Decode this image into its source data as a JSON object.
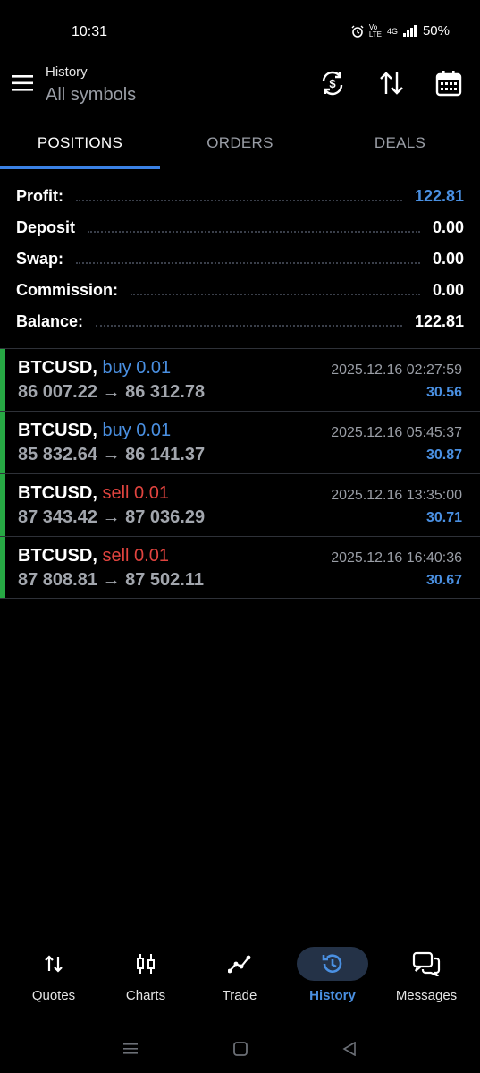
{
  "status_bar": {
    "time": "10:31",
    "network": "4G",
    "battery": "50%"
  },
  "header": {
    "title": "History",
    "subtitle": "All symbols"
  },
  "tabs": [
    {
      "label": "POSITIONS",
      "active": true
    },
    {
      "label": "ORDERS",
      "active": false
    },
    {
      "label": "DEALS",
      "active": false
    }
  ],
  "summary": {
    "profit": {
      "label": "Profit:",
      "value": "122.81"
    },
    "deposit": {
      "label": "Deposit",
      "value": "0.00"
    },
    "swap": {
      "label": "Swap:",
      "value": "0.00"
    },
    "commission": {
      "label": "Commission:",
      "value": "0.00"
    },
    "balance": {
      "label": "Balance:",
      "value": "122.81"
    }
  },
  "deals": [
    {
      "symbol": "BTCUSD,",
      "side": "buy 0.01",
      "prices": "86 007.22 → 86 312.78",
      "time": "2025.12.16 02:27:59",
      "profit": "30.56"
    },
    {
      "symbol": "BTCUSD,",
      "side": "buy 0.01",
      "prices": "85 832.64 → 86 141.37",
      "time": "2025.12.16 05:45:37",
      "profit": "30.87"
    },
    {
      "symbol": "BTCUSD,",
      "side": "sell 0.01",
      "prices": "87 343.42 → 87 036.29",
      "time": "2025.12.16 13:35:00",
      "profit": "30.71"
    },
    {
      "symbol": "BTCUSD,",
      "side": "sell 0.01",
      "prices": "87 808.81 → 87 502.11",
      "time": "2025.12.16 16:40:36",
      "profit": "30.67"
    }
  ],
  "bottom_nav": [
    {
      "label": "Quotes",
      "icon": "quotes-icon"
    },
    {
      "label": "Charts",
      "icon": "charts-icon"
    },
    {
      "label": "Trade",
      "icon": "trade-icon"
    },
    {
      "label": "History",
      "icon": "history-icon",
      "active": true
    },
    {
      "label": "Messages",
      "icon": "messages-icon"
    }
  ],
  "colors": {
    "accent": "#4a90e2",
    "sell": "#e0443f",
    "win_bar": "#27a844",
    "background": "#000000"
  }
}
